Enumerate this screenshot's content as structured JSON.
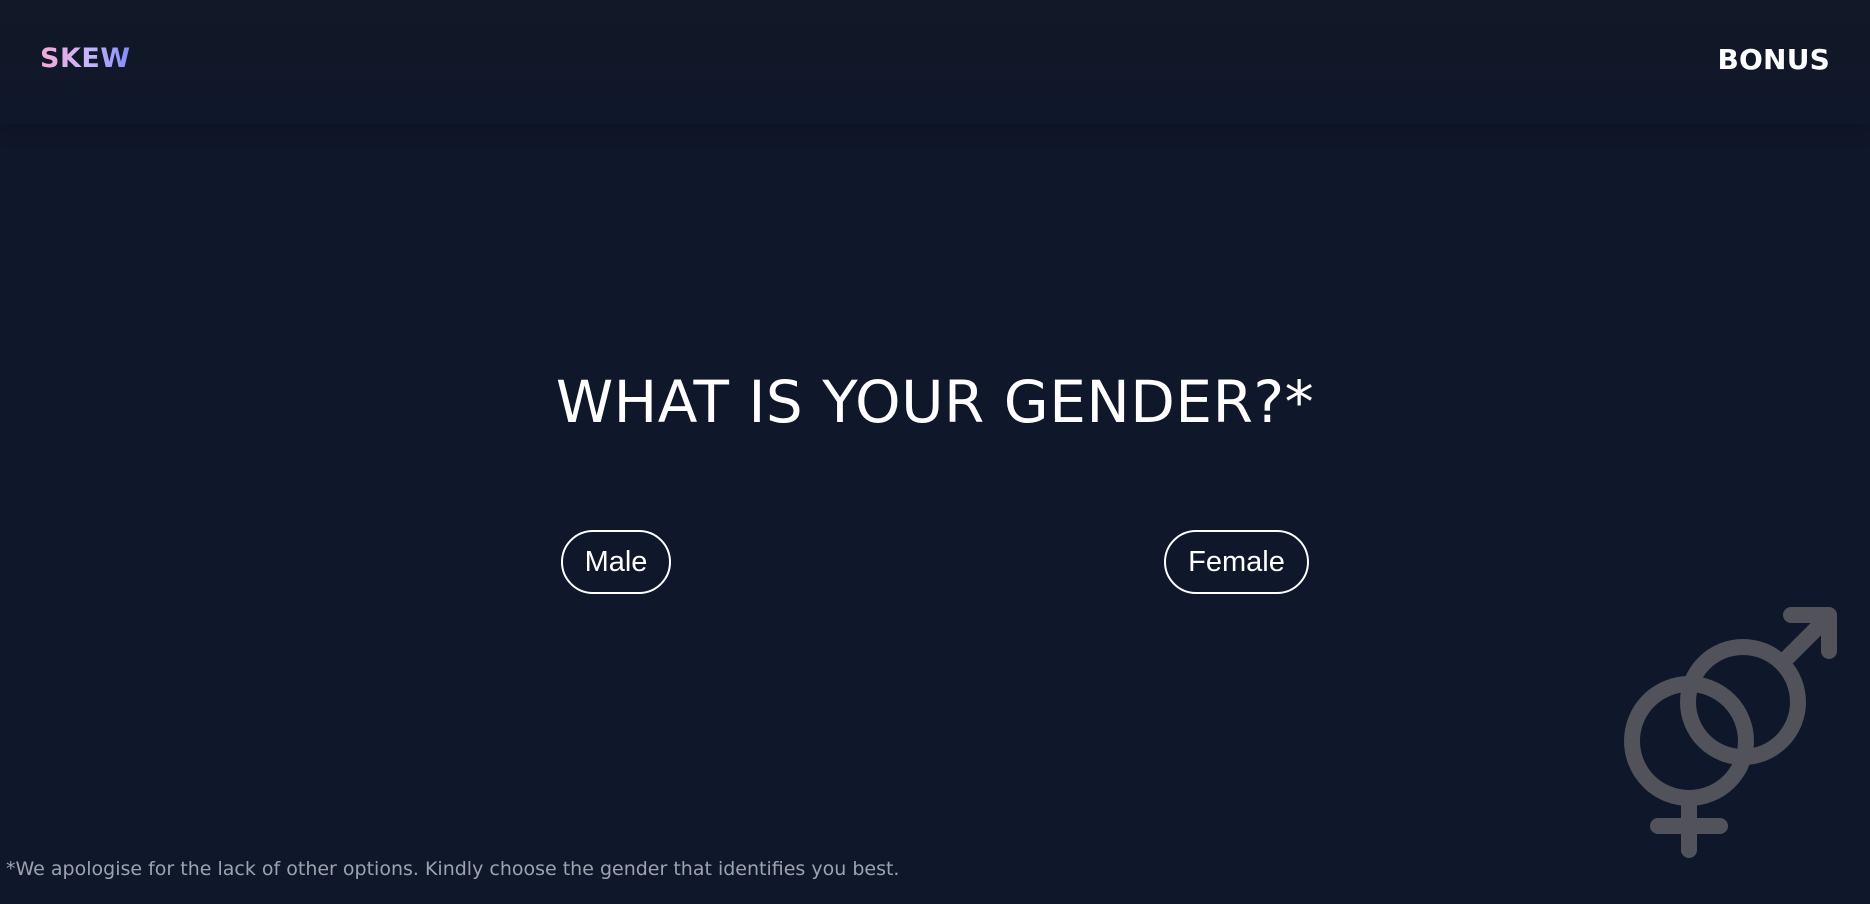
{
  "header": {
    "logo_text": "SKEW",
    "bonus_link": "BONUS"
  },
  "main": {
    "question": "WHAT IS YOUR GENDER?*",
    "options": [
      {
        "label": "Male"
      },
      {
        "label": "Female"
      }
    ]
  },
  "decoration": {
    "icon": "gender-symbols-icon",
    "color": "#52525b"
  },
  "footer": {
    "note": "*We apologise for the lack of other options. Kindly choose the gender that identifies you best."
  },
  "colors": {
    "background": "#0f172a",
    "text": "#ffffff",
    "muted_text": "#9ca3af",
    "logo_gradient_start": "#f9a8d4",
    "logo_gradient_end": "#818cf8"
  }
}
